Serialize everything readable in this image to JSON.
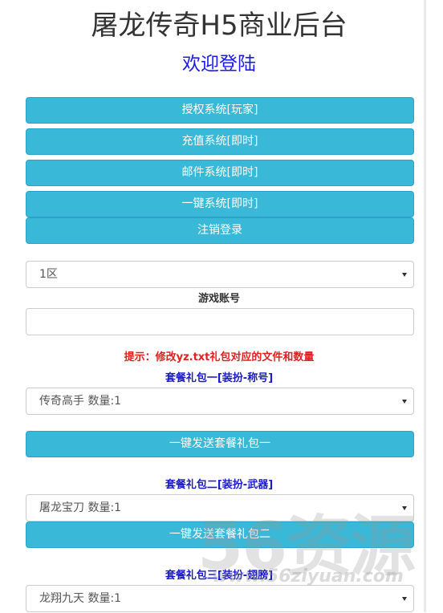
{
  "header": {
    "title": "屠龙传奇H5商业后台",
    "subtitle": "欢迎登陆"
  },
  "menu": {
    "buttons": [
      {
        "label": "授权系统[玩家]"
      },
      {
        "label": "充值系统[即时]"
      },
      {
        "label": "邮件系统[即时]"
      },
      {
        "label": "一键系统[即时]"
      },
      {
        "label": "注销登录"
      }
    ]
  },
  "form": {
    "server_select": "1区",
    "account_label": "游戏账号",
    "account_value": "",
    "hint": "提示：修改yz.txt礼包对应的文件和数量"
  },
  "packages": [
    {
      "title": "套餐礼包一[装扮-称号]",
      "selected": "传奇高手 数量:1",
      "send_label": "一键发送套餐礼包一"
    },
    {
      "title": "套餐礼包二[装扮-武器]",
      "selected": "屠龙宝刀 数量:1",
      "send_label": "一键发送套餐礼包二"
    },
    {
      "title": "套餐礼包三[装扮-翅膀]",
      "selected": "龙翔九天 数量:1"
    }
  ],
  "watermark": {
    "main": "56资源",
    "url": "www.56ziyuan.com"
  },
  "colors": {
    "button_bg": "#3ab8d8",
    "subtitle": "#1a1aee",
    "hint": "#e02020",
    "package_title": "#1a1ac8"
  }
}
